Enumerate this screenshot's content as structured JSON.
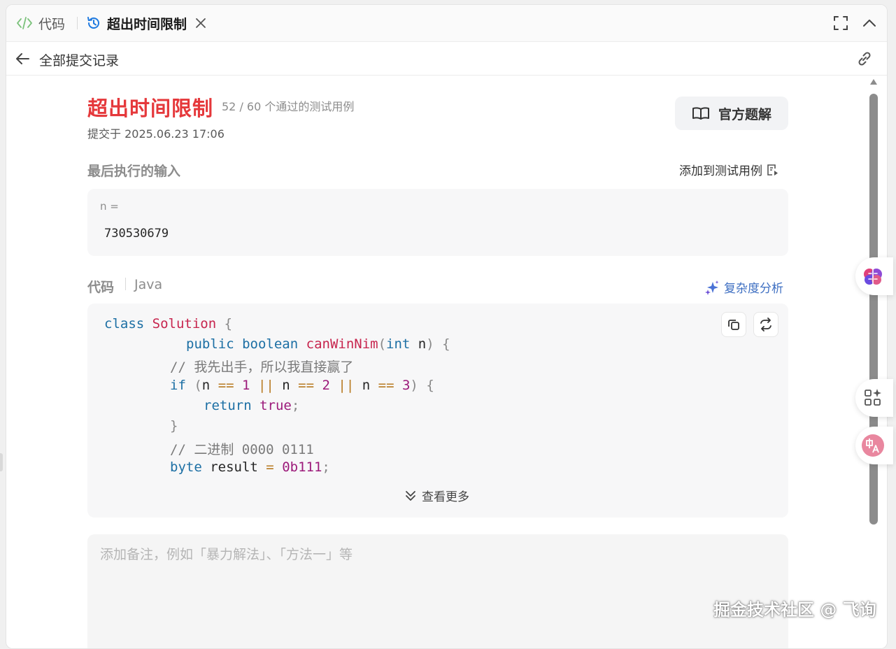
{
  "tabs": {
    "code_label": "代码",
    "active_label": "超出时间限制"
  },
  "subheader": {
    "title": "全部提交记录"
  },
  "result": {
    "status": "超出时间限制",
    "pass_info": "52 / 60 个通过的测试用例",
    "submitted_at": "提交于 2025.06.23 17:06",
    "official_solution_label": "官方题解",
    "status_color": "#e5383b"
  },
  "last_input": {
    "heading": "最后执行的输入",
    "add_to_tests_label": "添加到测试用例",
    "var_label": "n =",
    "value": "730530679"
  },
  "code": {
    "heading": "代码",
    "language": "Java",
    "complexity_label": "复杂度分析",
    "see_more_label": "查看更多",
    "lines": [
      "class Solution {",
      "public boolean canWinNim(int n) {",
      "// 我先出手，所以我直接赢了",
      "if (n == 1 || n == 2 || n == 3) {",
      "return true;",
      "}",
      "// 二进制 0000 0111",
      "byte result = 0b111;"
    ]
  },
  "note": {
    "placeholder": "添加备注，例如「暴力解法」、「方法一」等"
  },
  "watermark": "掘金技术社区 @ 飞询",
  "icons": [
    "code-icon",
    "history-icon",
    "close-icon",
    "fullscreen-icon",
    "chevron-up-icon",
    "back-arrow-icon",
    "link-icon",
    "book-icon",
    "add-testcase-icon",
    "sparkle-icon",
    "copy-icon",
    "swap-icon",
    "double-chevron-down-icon",
    "brain-icon",
    "apps-sparkle-icon",
    "translate-icon"
  ]
}
